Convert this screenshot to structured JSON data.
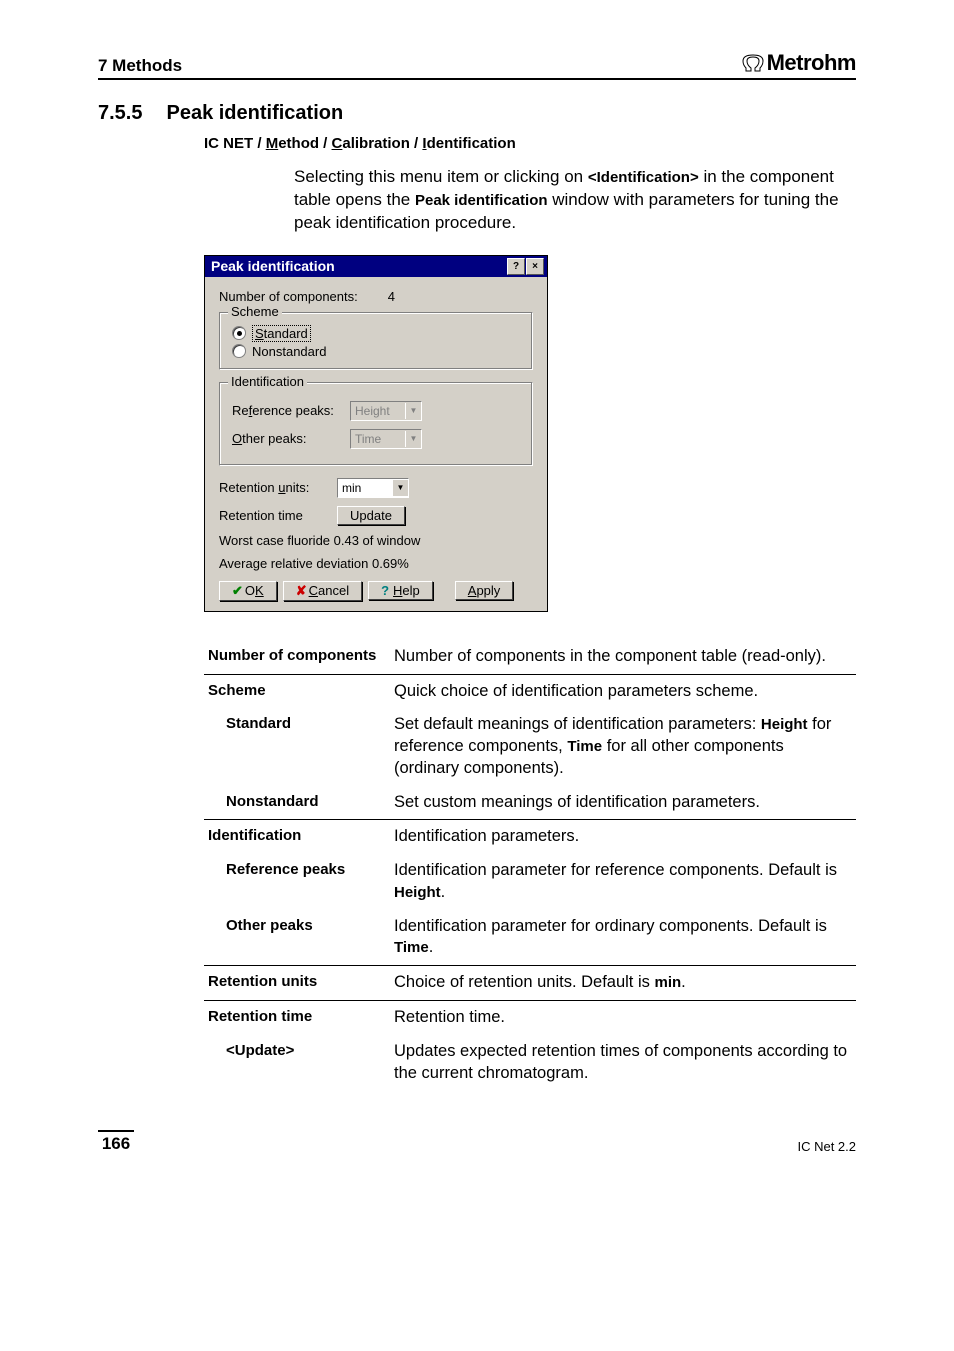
{
  "header": {
    "left": "7  Methods",
    "logo": "Metrohm"
  },
  "section": {
    "num": "7.5.5",
    "title": "Peak identification"
  },
  "breadcrumb": {
    "app": "IC NET",
    "p1_u": "M",
    "p1_r": "ethod",
    "p2_u": "C",
    "p2_r": "alibration",
    "p3_u": "I",
    "p3_r": "dentification"
  },
  "intro": {
    "t1": "Selecting this menu item or clicking on ",
    "b1": "<Identification>",
    "t2": " in the component table opens the ",
    "b2": "Peak identification",
    "t3": " window with parameters for tuning the peak identification procedure."
  },
  "dialog": {
    "title": "Peak identification",
    "num_comp_label": "Number of components:",
    "num_comp_value": "4",
    "scheme_legend": "Scheme",
    "scheme_standard_u": "S",
    "scheme_standard_r": "tandard",
    "scheme_nonstd": "Nonstandard",
    "ident_legend": "Identification",
    "ref_label_pre": "Re",
    "ref_label_u": "f",
    "ref_label_post": "erence peaks:",
    "ref_value": "Height",
    "other_label_u": "O",
    "other_label_r": "ther peaks:",
    "other_value": "Time",
    "units_label_pre": "Retention ",
    "units_label_u": "u",
    "units_label_post": "nits:",
    "units_value": "min",
    "rettime_label": "Retention time",
    "update_btn": "Update",
    "status1": "Worst case fluoride 0.43 of window",
    "status2": "Average relative deviation 0.69%",
    "ok_u": "K",
    "ok_pre": "O",
    "cancel_u": "C",
    "cancel_r": "ancel",
    "help_u": "H",
    "help_r": "elp",
    "apply_u": "A",
    "apply_r": "pply"
  },
  "params": {
    "numcomp_term": "Number of components",
    "numcomp_desc": "Number of components in the component table (read-only).",
    "scheme_term": "Scheme",
    "scheme_desc": "Quick choice of identification parameters scheme.",
    "standard_term": "Standard",
    "standard_desc_1": "Set default meanings of identification parameters: ",
    "standard_desc_b1": "Height",
    "standard_desc_2": " for reference components, ",
    "standard_desc_b2": "Time",
    "standard_desc_3": " for all other components (ordinary components).",
    "nonstd_term": "Nonstandard",
    "nonstd_desc": "Set custom meanings of identification parameters.",
    "ident_term": "Identification",
    "ident_desc": "Identification parameters.",
    "refpeaks_term": "Reference peaks",
    "refpeaks_desc_1": "Identification parameter for reference components. Default is ",
    "refpeaks_desc_b": "Height",
    "refpeaks_desc_2": ".",
    "otherpeaks_term": "Other peaks",
    "otherpeaks_desc_1": "Identification parameter for ordinary components. Default is ",
    "otherpeaks_desc_b": "Time",
    "otherpeaks_desc_2": ".",
    "retunits_term": "Retention units",
    "retunits_desc_1": "Choice of retention units. Default is ",
    "retunits_desc_b": "min",
    "retunits_desc_2": ".",
    "rettime_term": "Retention time",
    "rettime_desc": "Retention time.",
    "update_term": "<Update>",
    "update_desc": "Updates expected retention times of components according to the current chromatogram."
  },
  "footer": {
    "page": "166",
    "right": "IC Net 2.2"
  }
}
